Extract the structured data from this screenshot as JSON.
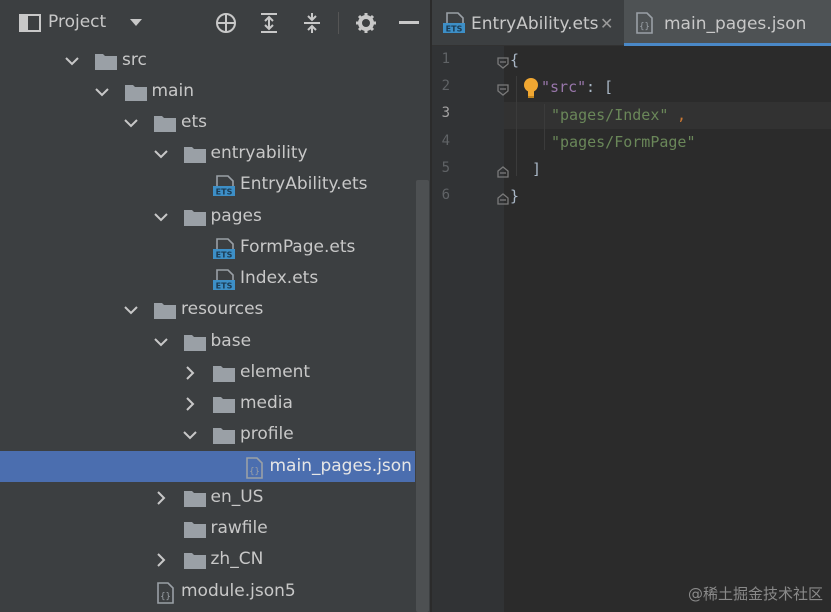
{
  "project_panel": {
    "title": "Project",
    "tree": [
      {
        "label": "src",
        "icon": "folder-icon",
        "chevron": "down"
      },
      {
        "label": "main",
        "icon": "folder-icon",
        "chevron": "down"
      },
      {
        "label": "ets",
        "icon": "folder-icon",
        "chevron": "down"
      },
      {
        "label": "entryability",
        "icon": "folder-icon",
        "chevron": "down"
      },
      {
        "label": "EntryAbility.ets",
        "icon": "ets-file-icon",
        "chevron": ""
      },
      {
        "label": "pages",
        "icon": "folder-icon",
        "chevron": "down"
      },
      {
        "label": "FormPage.ets",
        "icon": "ets-file-icon",
        "chevron": ""
      },
      {
        "label": "Index.ets",
        "icon": "ets-file-icon",
        "chevron": ""
      },
      {
        "label": "resources",
        "icon": "folder-icon",
        "chevron": "down"
      },
      {
        "label": "base",
        "icon": "folder-icon",
        "chevron": "down"
      },
      {
        "label": "element",
        "icon": "folder-icon",
        "chevron": "right"
      },
      {
        "label": "media",
        "icon": "folder-icon",
        "chevron": "right"
      },
      {
        "label": "profile",
        "icon": "folder-icon",
        "chevron": "down"
      },
      {
        "label": "main_pages.json",
        "icon": "json-file-icon",
        "chevron": "",
        "selected": true
      },
      {
        "label": "en_US",
        "icon": "folder-icon",
        "chevron": "right"
      },
      {
        "label": "rawfile",
        "icon": "folder-icon",
        "chevron": ""
      },
      {
        "label": "zh_CN",
        "icon": "folder-icon",
        "chevron": "right"
      },
      {
        "label": "module.json5",
        "icon": "json-file-icon",
        "chevron": ""
      }
    ]
  },
  "editor": {
    "tabs": [
      {
        "label": "EntryAbility.ets",
        "icon": "ets-file-icon",
        "active": false
      },
      {
        "label": "main_pages.json",
        "icon": "json-file-icon",
        "active": true
      }
    ],
    "line_numbers": [
      "1",
      "2",
      "3",
      "4",
      "5",
      "6"
    ],
    "code": {
      "line1": "{",
      "line2_key": "\"src\"",
      "line2_colon": ": [",
      "line3_str": "\"pages/Index\"",
      "line3_comma": ",",
      "line4_str": "\"pages/FormPage\"",
      "line5": "]",
      "line6": "}"
    }
  },
  "colors": {
    "selection": "#4b6eaf",
    "json_key": "#9876aa",
    "json_string": "#6a8759",
    "json_punctuation": "#cc7832",
    "folder": "#9aa0a6",
    "ets_icon": "#3d8fc7",
    "intention_bulb": "#f0a732"
  },
  "watermark": "@稀土掘金技术社区"
}
